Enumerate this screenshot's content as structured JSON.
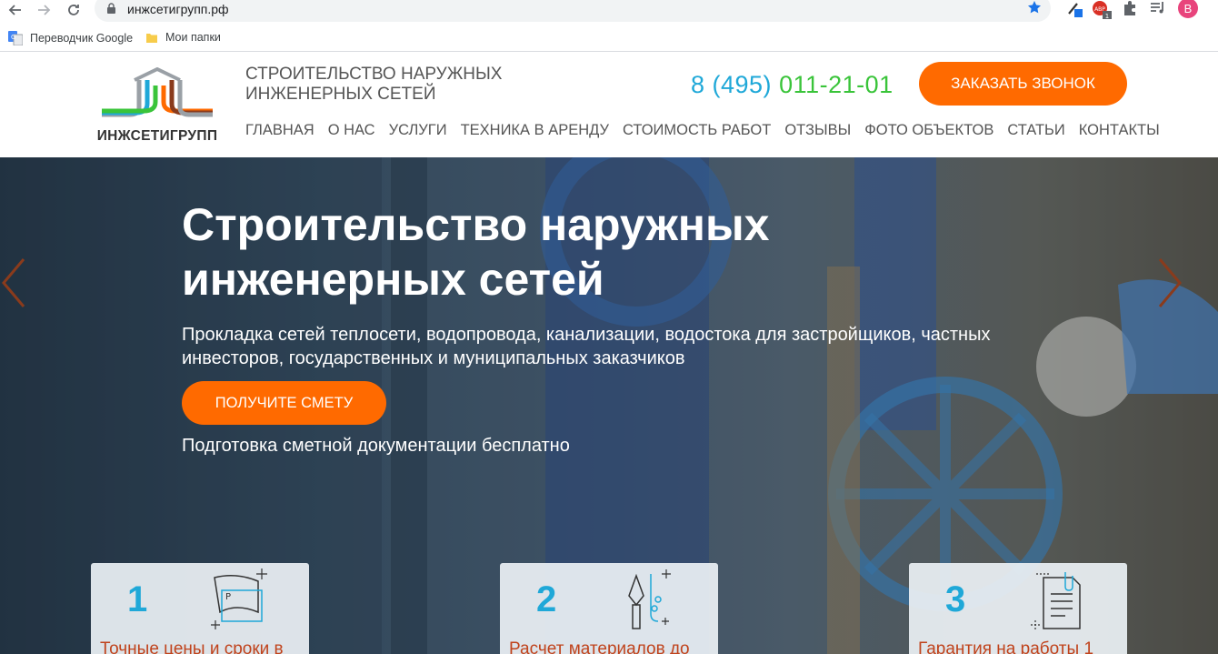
{
  "browser": {
    "url": "инжсетигрупп.рф",
    "profile_initial": "B",
    "bookmarks": [
      "Переводчик Google",
      "Мои папки"
    ]
  },
  "header": {
    "logo_text": "ИНЖСЕТИГРУПП",
    "tagline": "СТРОИТЕЛЬСТВО НАРУЖНЫХ ИНЖЕНЕРНЫХ СЕТЕЙ",
    "phone_prefix": "8 (495)",
    "phone_number": "011-21-01",
    "call_button": "ЗАКАЗАТЬ ЗВОНОК",
    "nav": [
      "ГЛАВНАЯ",
      "О НАС",
      "УСЛУГИ",
      "ТЕХНИКА В АРЕНДУ",
      "СТОИМОСТЬ РАБОТ",
      "ОТЗЫВЫ",
      "ФОТО ОБЪЕКТОВ",
      "СТАТЬИ",
      "КОНТАКТЫ"
    ]
  },
  "hero": {
    "title": "Строительство наружных инженерных сетей",
    "subtitle": "Прокладка сетей теплосети, водопровода, канализации, водостока для застройщиков, частных инвесторов, государственных и муниципальных заказчиков",
    "button": "ПОЛУЧИТЕ СМЕТУ",
    "note": "Подготовка сметной документации бесплатно"
  },
  "cards": [
    {
      "num": "1",
      "text": "Точные цены и сроки в",
      "icon": "drawing-plan-icon"
    },
    {
      "num": "2",
      "text": "Расчет материалов до",
      "icon": "pen-tools-icon"
    },
    {
      "num": "3",
      "text": "Гарантия на работы 1",
      "icon": "document-clip-icon"
    }
  ],
  "colors": {
    "accent_orange": "#ff6a00",
    "phone_blue": "#1fa8d8",
    "phone_green": "#3ac43a",
    "card_text": "#c0431c"
  }
}
